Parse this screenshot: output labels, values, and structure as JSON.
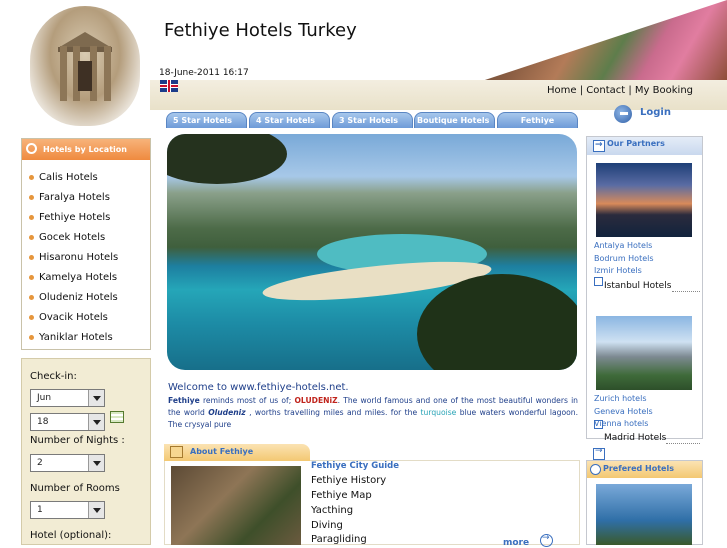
{
  "header": {
    "site_title": "Fethiye Hotels Turkey",
    "datetime": "18-June-2011 16:17",
    "links": [
      "Home",
      "Contact",
      "My Booking"
    ],
    "link_separator": " | "
  },
  "tabs": [
    "5 Star Hotels",
    "4 Star Hotels",
    "3 Star Hotels",
    "Boutique Hotels",
    "Fethiye"
  ],
  "login": {
    "label": "Login"
  },
  "locations": {
    "title": "Hotels by Location",
    "items": [
      "Calis Hotels",
      "Faralya Hotels",
      "Fethiye Hotels",
      "Gocek Hotels",
      "Hisaronu Hotels",
      "Kamelya Hotels",
      "Oludeniz Hotels",
      "Ovacik Hotels",
      "Yaniklar Hotels"
    ]
  },
  "search": {
    "checkin_label": "Check-in:",
    "month": "Jun",
    "day": "18",
    "nights_label": "Number of Nights :",
    "nights": "2",
    "rooms_label": "Number of Rooms",
    "rooms": "1",
    "hotel_label": "Hotel (optional):"
  },
  "welcome": {
    "title": "Welcome to www.fethiye-hotels.net.",
    "p1_bold": "Fethiye",
    "p1_a": " reminds most of us of; ",
    "p1_red": "OLUDENiZ",
    "p1_b": ". The world famous and one of the most beautiful wonders in the world ",
    "p1_it": "Oludeniz",
    "p1_c": " , worths travelling miles and miles. for the ",
    "p1_teal": "turquoise",
    "p1_d": " blue waters wonderful lagoon. The crysyal pure"
  },
  "about": {
    "title": "About Fethiye",
    "guide_title": "Fethiye City Guide",
    "items": [
      "Fethiye History",
      "Fethiye Map",
      "Yacthing",
      "Diving",
      "Paragliding"
    ],
    "more_label": "more"
  },
  "partners": {
    "title": "Our Partners",
    "group1_links": [
      "Antalya Hotels",
      "Bodrum Hotels",
      "Izmir Hotels"
    ],
    "group1_last": "Istanbul Hotels",
    "group2_links": [
      "Zurich hotels",
      "Geneva Hotels",
      "Vienna hotels"
    ],
    "group2_last": "Madrid Hotels"
  },
  "preferred": {
    "title": "Prefered Hotels"
  },
  "colors": {
    "tab_blue": "#6e9bd8",
    "orange_head": "#ef8a3f",
    "link_blue": "#3a6fbf",
    "search_bg": "#f2ecd4"
  }
}
